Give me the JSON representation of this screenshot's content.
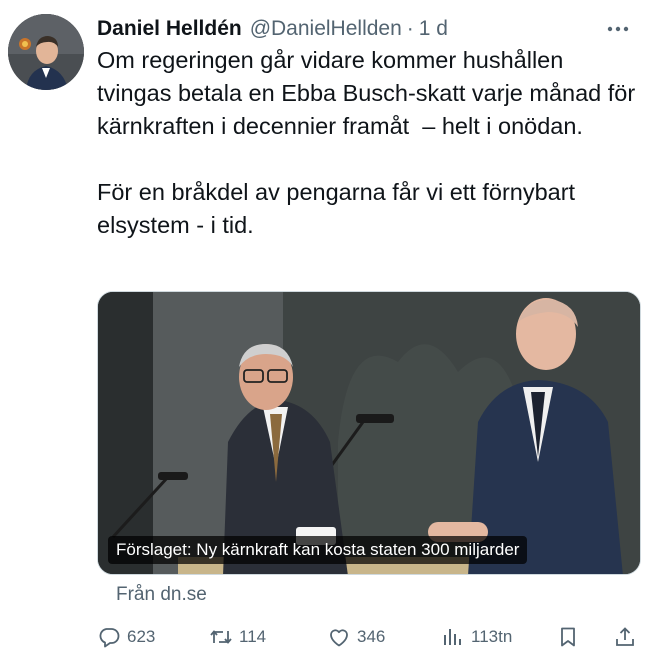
{
  "tweet": {
    "author_name": "Daniel Helldén",
    "author_handle": "@DanielHellden",
    "separator": "·",
    "time": "1 d",
    "text": "Om regeringen går vidare kommer hushållen tvingas betala en Ebba Busch-skatt varje månad för kärnkraften i decennier framåt  – helt i onödan.\n\nFör en bråkdel av pengarna får vi ett förnybart elsystem - i tid.",
    "card": {
      "caption": "Förslaget: Ny kärnkraft kan kosta staten 300 miljarder",
      "source": "Från dn.se"
    },
    "actions": {
      "replies": "623",
      "retweets": "114",
      "likes": "346",
      "views": "113tn"
    },
    "colors": {
      "text": "#0f1419",
      "secondary": "#536471",
      "background": "#ffffff"
    },
    "icons": [
      "more-icon",
      "reply-icon",
      "retweet-icon",
      "like-icon",
      "views-icon",
      "bookmark-icon",
      "share-icon"
    ]
  }
}
